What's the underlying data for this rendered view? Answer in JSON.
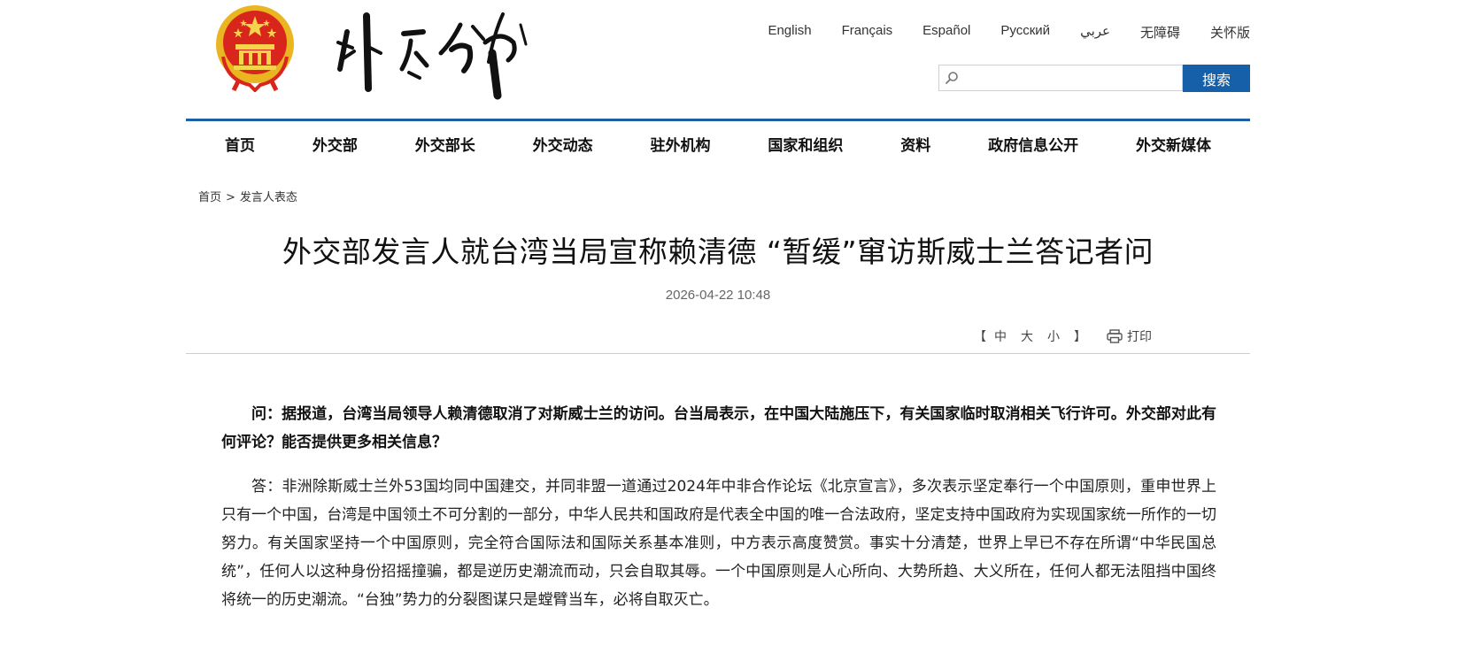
{
  "header": {
    "languages": [
      "English",
      "Français",
      "Español",
      "Русский",
      "عربي",
      "无障碍",
      "关怀版"
    ],
    "search": {
      "placeholder": "",
      "button_label": "搜索"
    }
  },
  "nav": {
    "items": [
      "首页",
      "外交部",
      "外交部长",
      "外交动态",
      "驻外机构",
      "国家和组织",
      "资料",
      "政府信息公开",
      "外交新媒体"
    ]
  },
  "breadcrumb": {
    "home": "首页",
    "separator": ">",
    "current": "发言人表态"
  },
  "article": {
    "title": "外交部发言人就台湾当局宣称赖清德 “暂缓”窜访斯威士兰答记者问",
    "date": "2026-04-22 10:48",
    "font_tools": {
      "open": "【",
      "large_label": "中",
      "medium_label": "大",
      "small_label": "小",
      "close": "】"
    },
    "print_label": "打印",
    "question": "问：据报道，台湾当局领导人赖清德取消了对斯威士兰的访问。台当局表示，在中国大陆施压下，有关国家临时取消相关飞行许可。外交部对此有何评论？能否提供更多相关信息？",
    "answer": "答：非洲除斯威士兰外53国均同中国建交，并同非盟一道通过2024年中非合作论坛《北京宣言》，多次表示坚定奉行一个中国原则，重申世界上只有一个中国，台湾是中国领土不可分割的一部分，中华人民共和国政府是代表全中国的唯一合法政府，坚定支持中国政府为实现国家统一所作的一切努力。有关国家坚持一个中国原则，完全符合国际法和国际关系基本准则，中方表示高度赞赏。事实十分清楚，世界上早已不存在所谓“中华民国总统”，任何人以这种身份招摇撞骗，都是逆历史潮流而动，只会自取其辱。一个中国原则是人心所向、大势所趋、大义所在，任何人都无法阻挡中国终将统一的历史潮流。“台独”势力的分裂图谋只是螳臂当车，必将自取灭亡。"
  },
  "colors": {
    "brand_blue": "#1d5fa6",
    "search_button": "#1560a8",
    "emblem_red": "#d9261c",
    "emblem_gold": "#f2c33a"
  }
}
